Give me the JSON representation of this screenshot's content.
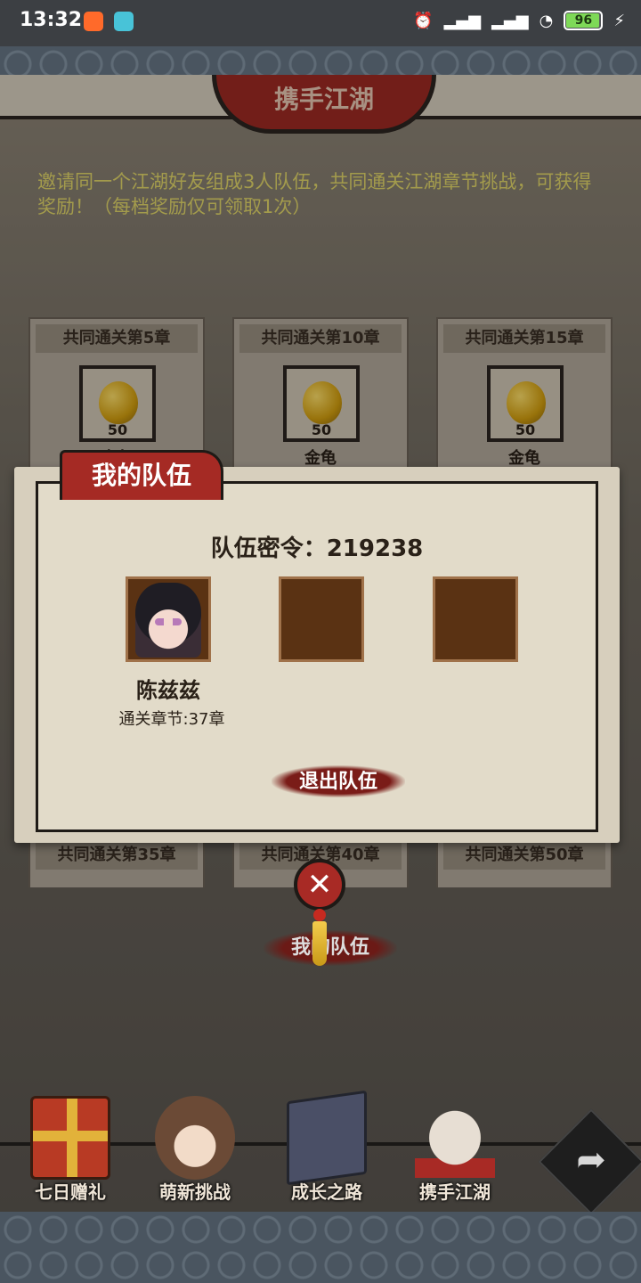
{
  "status_bar": {
    "time": "13:32",
    "battery": "96",
    "battery_level": 0.96,
    "icons": [
      "app-icon-orange",
      "app-icon-teal",
      "alarm-icon",
      "signal-icon",
      "hd-signal-icon",
      "wifi-icon",
      "battery-icon",
      "charging-icon"
    ]
  },
  "header": {
    "title": "携手江湖"
  },
  "intro": {
    "text": "邀请同一个江湖好友组成3人队伍，共同通关江湖章节挑战，可获得奖励！（每档奖励仅可领取1次）"
  },
  "rewards_top": [
    {
      "title": "共同通关第5章",
      "count": "50",
      "name": "金龟"
    },
    {
      "title": "共同通关第10章",
      "count": "50",
      "name": "金龟"
    },
    {
      "title": "共同通关第15章",
      "count": "50",
      "name": "金龟"
    }
  ],
  "rewards_bottom": [
    {
      "title": "共同通关第35章"
    },
    {
      "title": "共同通关第40章"
    },
    {
      "title": "共同通关第50章"
    }
  ],
  "modal": {
    "tab_label": "我的队伍",
    "team_code": "队伍密令：219238",
    "member": {
      "name": "陈兹兹",
      "chapter": "通关章节:37章"
    },
    "leave_label": "退出队伍"
  },
  "close": {
    "label": "✕"
  },
  "my_team_button": "我的队伍",
  "bottom_nav": [
    {
      "label": "七日赠礼",
      "icon": "gift-box-icon"
    },
    {
      "label": "萌新挑战",
      "icon": "girl-avatar-icon"
    },
    {
      "label": "成长之路",
      "icon": "book-icon"
    },
    {
      "label": "携手江湖",
      "icon": "handshake-icon"
    }
  ],
  "share": {
    "icon": "share-arrow-icon",
    "label": "➦"
  },
  "colors": {
    "accent_red": "#a52a24",
    "paper": "#e2dbc9",
    "intro_text": "#e7dc6a",
    "slot_brown": "#5a3213"
  }
}
